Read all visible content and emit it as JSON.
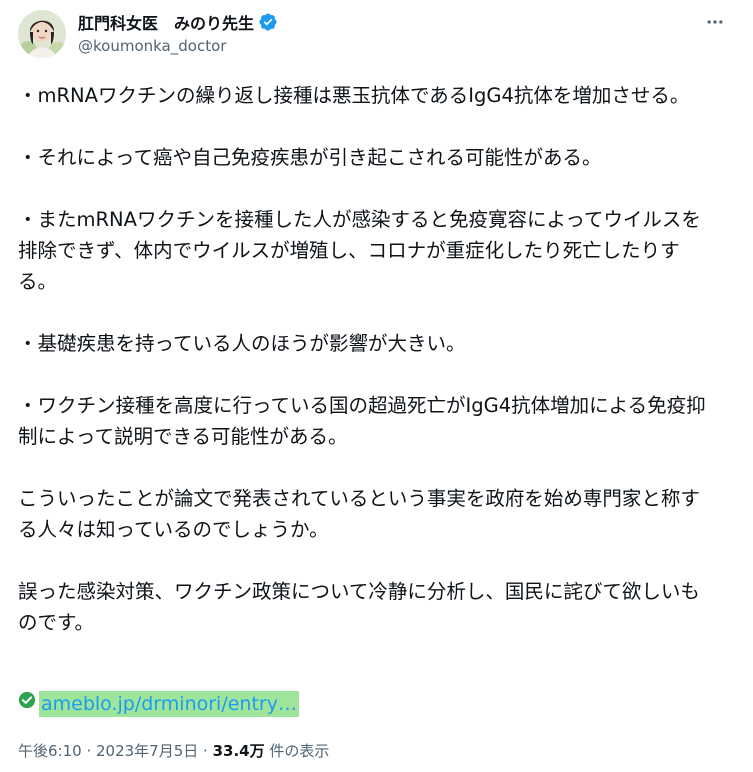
{
  "author": {
    "display_name": "肛門科女医　みのり先生",
    "handle": "@koumonka_doctor"
  },
  "tweet": {
    "paragraphs": [
      "・mRNAワクチンの繰り返し接種は悪玉抗体であるIgG4抗体を増加させる。",
      "・それによって癌や自己免疫疾患が引き起こされる可能性がある。",
      "・またmRNAワクチンを接種した人が感染すると免疫寛容によってウイルスを排除できず、体内でウイルスが増殖し、コロナが重症化したり死亡したりする。",
      "・基礎疾患を持っている人のほうが影響が大きい。",
      "・ワクチン接種を高度に行っている国の超過死亡がIgG4抗体増加による免疫抑制によって説明できる可能性がある。",
      "こういったことが論文で発表されているという事実を政府を始め専門家と称する人々は知っているのでしょうか。",
      "誤った感染対策、ワクチン政策について冷静に分析し、国民に詫びて欲しいものです。"
    ],
    "link_text": "ameblo.jp/drminori/entry…"
  },
  "meta": {
    "time": "午後6:10",
    "separator": " · ",
    "date": "2023年7月5日",
    "views_count": "33.4万",
    "views_label": " 件の表示"
  },
  "colors": {
    "link": "#1d9bf0",
    "link_highlight": "#9ee59b",
    "verified": "#1d9bf0",
    "check": "#2ea44f",
    "secondary_text": "#536471"
  },
  "icons": {
    "verified": "verified-badge-icon",
    "more": "more-horizontal-icon",
    "check": "check-circle-icon"
  }
}
